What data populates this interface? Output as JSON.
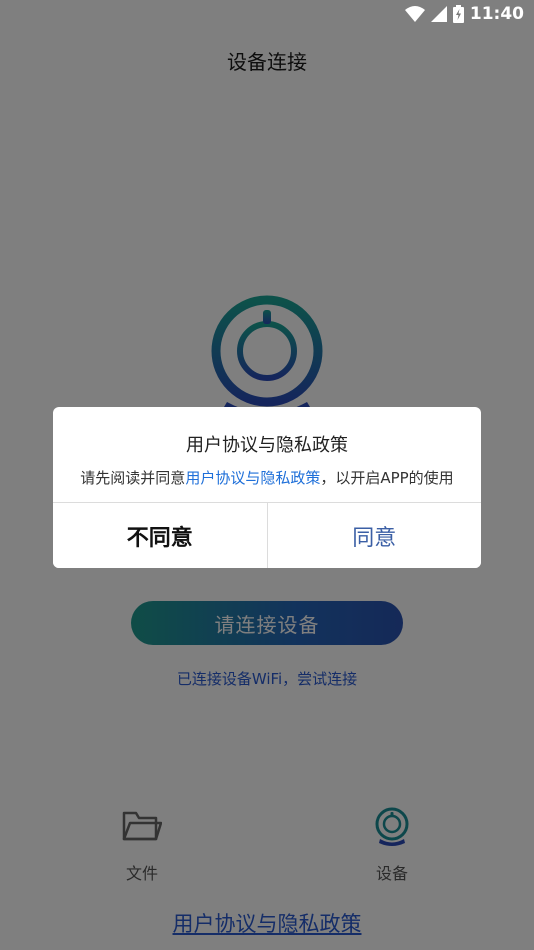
{
  "status_bar": {
    "time": "11:40",
    "icons": [
      "wifi-icon",
      "cellular-signal-icon",
      "battery-charging-icon"
    ]
  },
  "header": {
    "title": "设备连接"
  },
  "main": {
    "hero_icon": "camera-device-icon",
    "connect_button_label": "请连接设备",
    "wifi_link_text": "已连接设备WiFi，尝试连接"
  },
  "bottom_nav": {
    "items": [
      {
        "label": "文件",
        "icon": "folder-icon"
      },
      {
        "label": "设备",
        "icon": "camera-device-icon"
      }
    ]
  },
  "footer": {
    "policy_link": "用户协议与隐私政策"
  },
  "dialog": {
    "title": "用户协议与隐私政策",
    "message_prefix": "请先阅读并同意",
    "message_link": "用户协议与隐私政策",
    "message_suffix": "，以开启APP的使用",
    "disagree_label": "不同意",
    "agree_label": "同意"
  },
  "colors": {
    "accent_blue": "#2a5bd0",
    "gradient_start": "#1f9a8e",
    "gradient_end": "#2a52b0",
    "overlay": "rgba(0,0,0,0.5)"
  }
}
